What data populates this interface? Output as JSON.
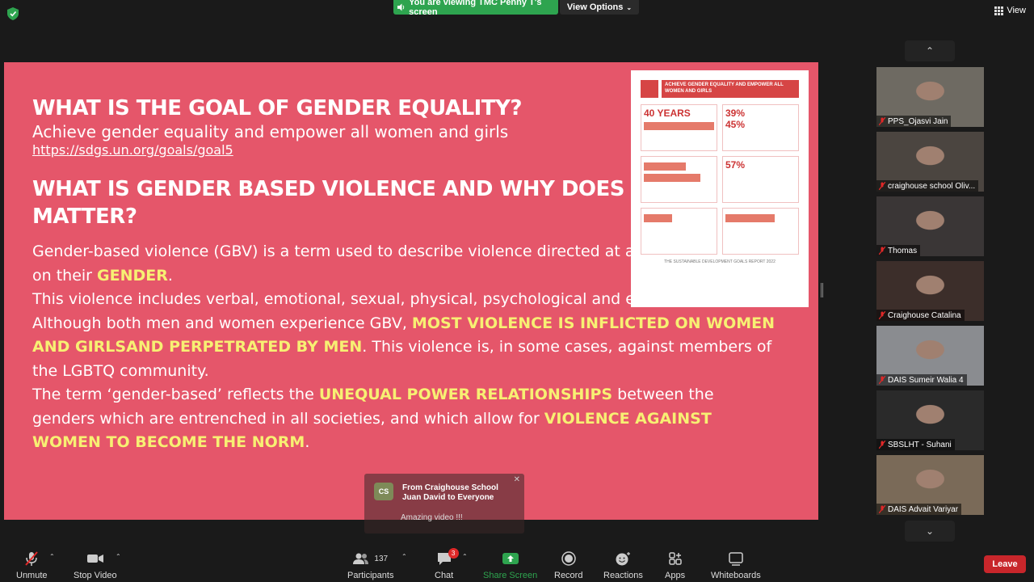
{
  "top": {
    "sharing_banner": "You are viewing TMC Penny T's screen",
    "view_options": "View Options",
    "view_label": "View"
  },
  "slide": {
    "heading1": "WHAT IS THE GOAL OF GENDER EQUALITY?",
    "subtitle": "Achieve gender equality and empower all women and girls",
    "link": "https://sdgs.un.org/goals/goal5",
    "heading2": "WHAT IS GENDER BASED VIOLENCE AND WHY DOES IT MATTER?",
    "p1a": "Gender-based violence (GBV) is a term used to describe violence directed at an individual based on their ",
    "p1b": "GENDER",
    "p1c": ".",
    "p2": "This violence includes verbal, emotional, sexual, physical, psychological and economic abuse.",
    "p3a": "Although both men and women experience GBV, ",
    "p3b": "MOST VIOLENCE IS INFLICTED ON WOMEN AND GIRLSAND PERPETRATED BY MEN",
    "p3c": ". This violence is, in some cases, against members of the LGBTQ community.",
    "p4a": "The term ‘gender-based’ reflects the ",
    "p4b": "UNEQUAL POWER RELATIONSHIPS",
    "p4c": "  between the genders which are entrenched in all societies, and which allow for ",
    "p4d": "VIOLENCE AGAINST WOMEN TO BECOME THE NORM",
    "p4e": ".",
    "infographic": {
      "title": "ACHIEVE GENDER EQUALITY AND EMPOWER ALL WOMEN AND GIRLS",
      "stat1": "40 YEARS",
      "stat2": "39%",
      "stat3": "45%",
      "stat4": "57%",
      "footer": "THE SUSTAINABLE DEVELOPMENT GOALS REPORT 2022"
    }
  },
  "notification": {
    "avatar": "CS",
    "from": "From Craighouse School Juan David to Everyone",
    "message": "Amazing video !!!"
  },
  "participants": [
    {
      "name": "PPS_Ojasvi Jain",
      "bg": "#6e6a62"
    },
    {
      "name": "craighouse school Oliv...",
      "bg": "#4b4540"
    },
    {
      "name": "Thomas",
      "bg": "#3a3636"
    },
    {
      "name": "Craighouse Catalina",
      "bg": "#3c2e2a"
    },
    {
      "name": "DAIS Sumeir Walia 4",
      "bg": "#8a8c90"
    },
    {
      "name": "SBSLHT - Suhani",
      "bg": "#2a2a2a"
    },
    {
      "name": "DAIS Advait Variyar",
      "bg": "#7a6a58"
    }
  ],
  "toolbar": {
    "unmute": "Unmute",
    "stop_video": "Stop Video",
    "participants_count": "137",
    "participants": "Participants",
    "chat_badge": "3",
    "chat": "Chat",
    "share_screen": "Share Screen",
    "record": "Record",
    "reactions": "Reactions",
    "apps": "Apps",
    "whiteboards": "Whiteboards",
    "leave": "Leave"
  },
  "colors": {
    "slide_bg": "#e5566a",
    "highlight": "#f7f073",
    "share_green": "#2ea44f",
    "leave_red": "#c8262b"
  }
}
